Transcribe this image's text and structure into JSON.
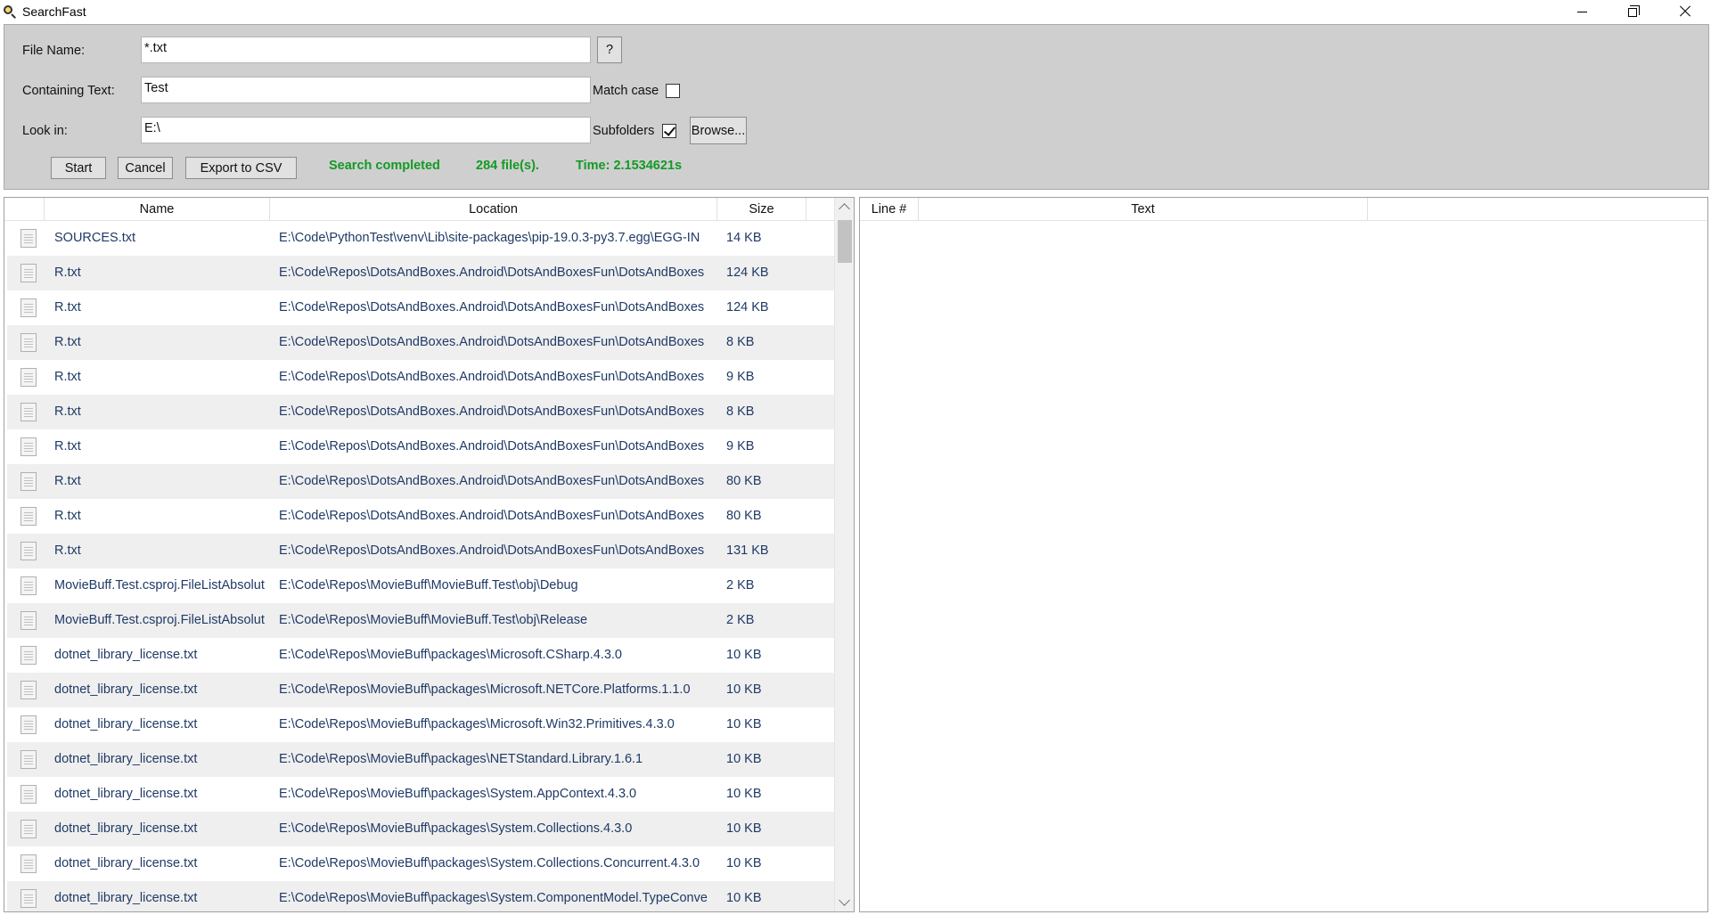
{
  "app": {
    "title": "SearchFast"
  },
  "window": {
    "minimize": "minimize",
    "restore": "restore",
    "close": "close"
  },
  "search": {
    "file_name_label": "File Name:",
    "file_name_value": "*.txt",
    "help_label": "?",
    "containing_label": "Containing Text:",
    "containing_value": "Test",
    "match_case_label": "Match case",
    "match_case_checked": false,
    "look_in_label": "Look in:",
    "look_in_value": "E:\\",
    "subfolders_label": "Subfolders",
    "subfolders_checked": true,
    "browse_label": "Browse...",
    "start_label": "Start",
    "cancel_label": "Cancel",
    "export_label": "Export to CSV"
  },
  "status": {
    "message": "Search completed",
    "count": "284 file(s).",
    "time": "Time: 2.1534621s",
    "color": "#139a26"
  },
  "results": {
    "columns": {
      "name": "Name",
      "location": "Location",
      "size": "Size"
    },
    "rows": [
      {
        "name": "SOURCES.txt",
        "location": "E:\\Code\\PythonTest\\venv\\Lib\\site-packages\\pip-19.0.3-py3.7.egg\\EGG-IN",
        "size": "14 KB"
      },
      {
        "name": "R.txt",
        "location": "E:\\Code\\Repos\\DotsAndBoxes.Android\\DotsAndBoxesFun\\DotsAndBoxes",
        "size": "124 KB"
      },
      {
        "name": "R.txt",
        "location": "E:\\Code\\Repos\\DotsAndBoxes.Android\\DotsAndBoxesFun\\DotsAndBoxes",
        "size": "124 KB"
      },
      {
        "name": "R.txt",
        "location": "E:\\Code\\Repos\\DotsAndBoxes.Android\\DotsAndBoxesFun\\DotsAndBoxes",
        "size": "8 KB"
      },
      {
        "name": "R.txt",
        "location": "E:\\Code\\Repos\\DotsAndBoxes.Android\\DotsAndBoxesFun\\DotsAndBoxes",
        "size": "9 KB"
      },
      {
        "name": "R.txt",
        "location": "E:\\Code\\Repos\\DotsAndBoxes.Android\\DotsAndBoxesFun\\DotsAndBoxes",
        "size": "8 KB"
      },
      {
        "name": "R.txt",
        "location": "E:\\Code\\Repos\\DotsAndBoxes.Android\\DotsAndBoxesFun\\DotsAndBoxes",
        "size": "9 KB"
      },
      {
        "name": "R.txt",
        "location": "E:\\Code\\Repos\\DotsAndBoxes.Android\\DotsAndBoxesFun\\DotsAndBoxes",
        "size": "80 KB"
      },
      {
        "name": "R.txt",
        "location": "E:\\Code\\Repos\\DotsAndBoxes.Android\\DotsAndBoxesFun\\DotsAndBoxes",
        "size": "80 KB"
      },
      {
        "name": "R.txt",
        "location": "E:\\Code\\Repos\\DotsAndBoxes.Android\\DotsAndBoxesFun\\DotsAndBoxes",
        "size": "131 KB"
      },
      {
        "name": "MovieBuff.Test.csproj.FileListAbsolut",
        "location": "E:\\Code\\Repos\\MovieBuff\\MovieBuff.Test\\obj\\Debug",
        "size": "2 KB"
      },
      {
        "name": "MovieBuff.Test.csproj.FileListAbsolut",
        "location": "E:\\Code\\Repos\\MovieBuff\\MovieBuff.Test\\obj\\Release",
        "size": "2 KB"
      },
      {
        "name": "dotnet_library_license.txt",
        "location": "E:\\Code\\Repos\\MovieBuff\\packages\\Microsoft.CSharp.4.3.0",
        "size": "10 KB"
      },
      {
        "name": "dotnet_library_license.txt",
        "location": "E:\\Code\\Repos\\MovieBuff\\packages\\Microsoft.NETCore.Platforms.1.1.0",
        "size": "10 KB"
      },
      {
        "name": "dotnet_library_license.txt",
        "location": "E:\\Code\\Repos\\MovieBuff\\packages\\Microsoft.Win32.Primitives.4.3.0",
        "size": "10 KB"
      },
      {
        "name": "dotnet_library_license.txt",
        "location": "E:\\Code\\Repos\\MovieBuff\\packages\\NETStandard.Library.1.6.1",
        "size": "10 KB"
      },
      {
        "name": "dotnet_library_license.txt",
        "location": "E:\\Code\\Repos\\MovieBuff\\packages\\System.AppContext.4.3.0",
        "size": "10 KB"
      },
      {
        "name": "dotnet_library_license.txt",
        "location": "E:\\Code\\Repos\\MovieBuff\\packages\\System.Collections.4.3.0",
        "size": "10 KB"
      },
      {
        "name": "dotnet_library_license.txt",
        "location": "E:\\Code\\Repos\\MovieBuff\\packages\\System.Collections.Concurrent.4.3.0",
        "size": "10 KB"
      },
      {
        "name": "dotnet_library_license.txt",
        "location": "E:\\Code\\Repos\\MovieBuff\\packages\\System.ComponentModel.TypeConve",
        "size": "10 KB"
      }
    ]
  },
  "detail": {
    "columns": {
      "line": "Line #",
      "text": "Text"
    }
  }
}
